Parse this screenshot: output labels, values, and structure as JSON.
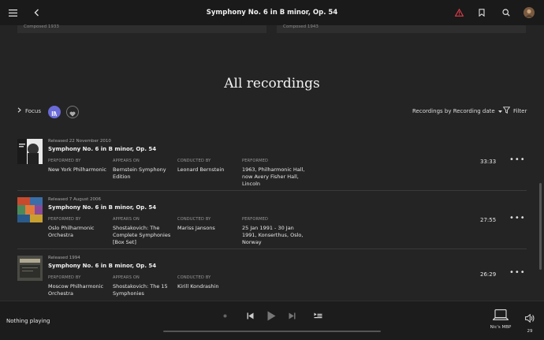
{
  "header": {
    "title": "Symphony No. 6 in B minor, Op. 54",
    "menu_icon": "hamburger-icon",
    "back_icon": "chevron-left-icon",
    "alert_icon": "warning-icon",
    "bookmark_icon": "bookmark-icon",
    "search_icon": "search-icon",
    "alert_color": "#e03c4a"
  },
  "top_cards": [
    {
      "text": "Composed 1933"
    },
    {
      "text": "Composed 1943"
    }
  ],
  "section_title": "All recordings",
  "toolbar": {
    "focus_label": "Focus",
    "sort_label": "Recordings by Recording date",
    "filter_label": "Filter",
    "accent": "#6a6ad8"
  },
  "labels": {
    "performed_by": "PERFORMED BY",
    "appears_on": "APPEARS ON",
    "conducted_by": "CONDUCTED BY",
    "performed": "PERFORMED"
  },
  "recordings": [
    {
      "released": "Released 22 November 2010",
      "title": "Symphony No. 6 in B minor, Op. 54",
      "performed_by": "New York Philharmonic",
      "appears_on": "Bernstein Symphony Edition",
      "conducted_by": "Leonard Bernstein",
      "performed": "1963, Philharmonic Hall, now Avery Fisher Hall, Lincoln",
      "duration": "33:33"
    },
    {
      "released": "Released 7 August 2006",
      "title": "Symphony No. 6 in B minor, Op. 54",
      "performed_by": "Oslo Philharmonic Orchestra",
      "appears_on": "Shostakovich: The Complete Symphonies [Box Set]",
      "conducted_by": "Mariss Jansons",
      "performed": "25 Jan 1991 - 30 Jan 1991, Konserthus, Oslo, Norway",
      "duration": "27:55"
    },
    {
      "released": "Released 1994",
      "title": "Symphony No. 6 in B minor, Op. 54",
      "performed_by": "Moscow Philharmonic Orchestra",
      "appears_on": "Shostakovich: The 15 Symphonies",
      "conducted_by": "Kirill Kondrashin",
      "performed": "",
      "duration": "26:29"
    }
  ],
  "player": {
    "now_playing": "Nothing playing",
    "device": "Nic's MBP",
    "volume": "29"
  }
}
